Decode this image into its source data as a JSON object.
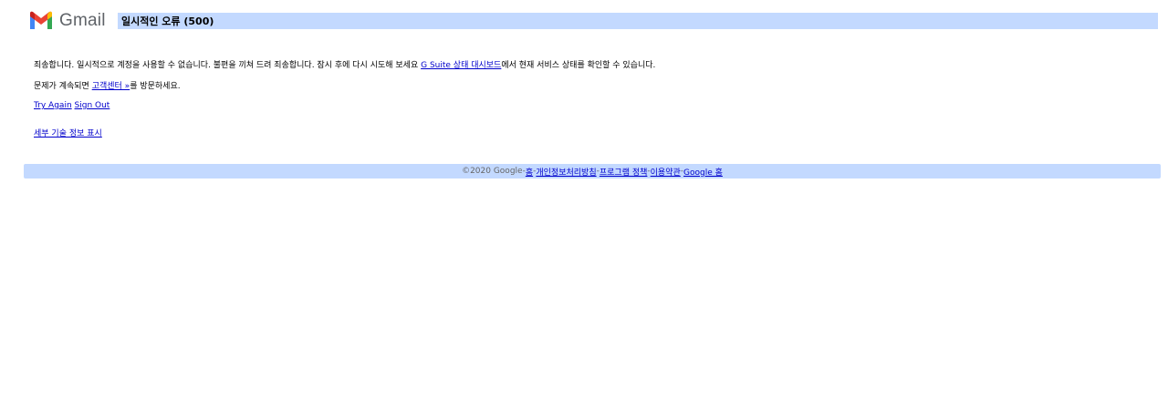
{
  "header": {
    "logo_text": "Gmail",
    "logo_icon": "gmail-m-icon",
    "title": "일시적인 오류 (500)"
  },
  "message": {
    "line1_prefix": "죄송합니다. 일시적으로 계정을 사용할 수 없습니다. 불편을 끼쳐 드려 죄송합니다. 잠시 후에 다시 시도해 보세요 ",
    "line1_link": "G Suite 상태 대시보드",
    "line1_suffix": "에서 현재 서비스 상태를 확인할 수 있습니다.",
    "line2_prefix": "문제가 계속되면 ",
    "line2_link": "고객센터 »",
    "line2_suffix": "를 방문하세요."
  },
  "actions": {
    "try_again": "Try Again",
    "sign_out": "Sign Out"
  },
  "details_link": "세부 기술 정보 표시",
  "footer": {
    "copyright": "©2020 Google",
    "separator": " - ",
    "links": [
      "홈",
      "개인정보처리방침",
      "프로그램 정책",
      "이용약관",
      "Google 홈"
    ]
  },
  "colors": {
    "title_bar": "#c3d9ff",
    "link": "#0000cc",
    "footer_text": "#666666"
  }
}
